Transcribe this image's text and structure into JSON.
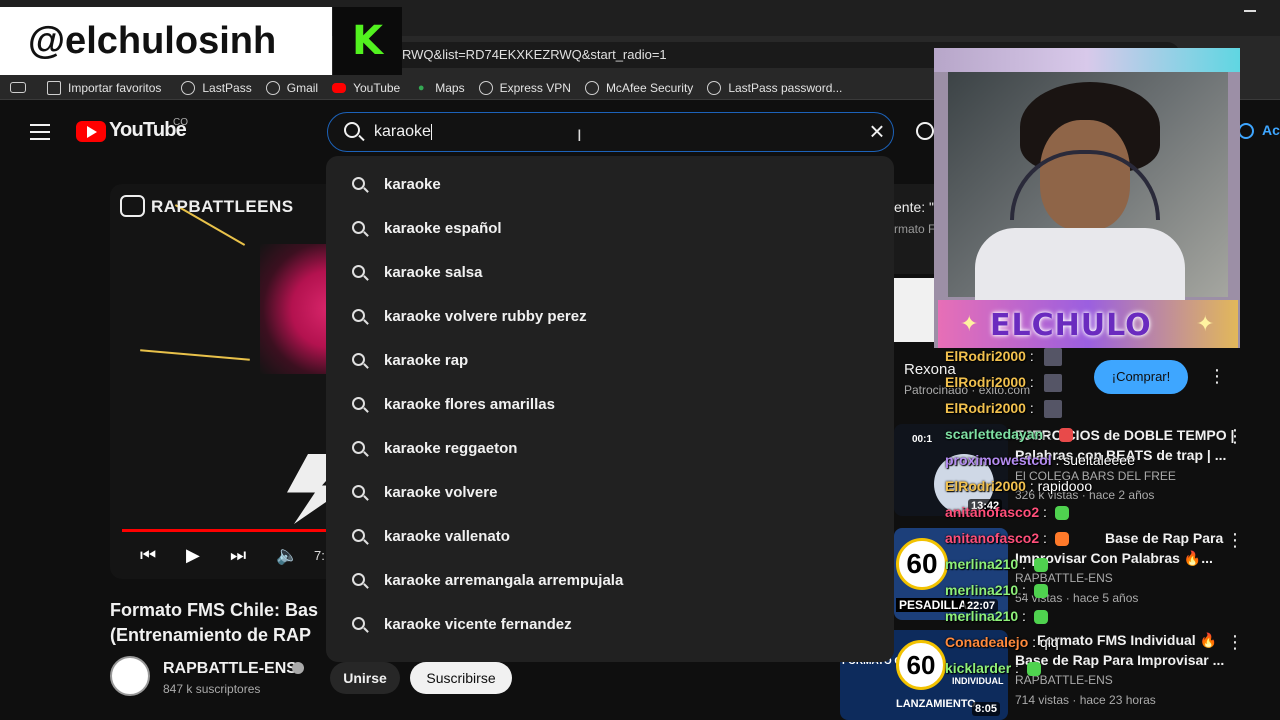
{
  "browser": {
    "url": "RWQ&list=RD74EKXKEZRWQ&start_radio=1",
    "bookmarks": [
      {
        "label": "Importar favoritos",
        "icon": "import-icon"
      },
      {
        "label": "LastPass",
        "icon": "globe-icon"
      },
      {
        "label": "Gmail",
        "icon": "globe-icon"
      },
      {
        "label": "YouTube",
        "icon": "youtube-icon"
      },
      {
        "label": "Maps",
        "icon": "maps-icon"
      },
      {
        "label": "Express VPN",
        "icon": "globe-icon"
      },
      {
        "label": "McAfee Security",
        "icon": "globe-icon"
      },
      {
        "label": "LastPass password...",
        "icon": "globe-icon"
      }
    ]
  },
  "overlay": {
    "handle": "@elchulosinh",
    "k_logo": "K",
    "webcam_banner": "ELCHULO"
  },
  "youtube": {
    "logo_text": "YouTube",
    "country": "CO",
    "search_value": "karaoke",
    "account_label": "Ac",
    "suggestions": [
      "karaoke",
      "karaoke español",
      "karaoke salsa",
      "karaoke volvere rubby perez",
      "karaoke rap",
      "karaoke flores amarillas",
      "karaoke reggaeton",
      "karaoke volvere",
      "karaoke vallenato",
      "karaoke arremangala arrempujala",
      "karaoke vicente fernandez"
    ]
  },
  "video": {
    "brand": "RAPBATTLEENS",
    "duration_partial": "7:",
    "title_line1": "Formato FMS Chile: Bas",
    "title_line2": "(Entrenamiento de RAP",
    "channel": "RAPBATTLE-ENS",
    "subscribers": "847 k suscriptores",
    "join_label": "Unirse",
    "subscribe_label": "Suscribirse"
  },
  "sidebar": {
    "partial_text_1": "ente: \"C",
    "partial_text_2": "rmato F",
    "ad": {
      "title": "Rexona",
      "meta": "Patrocinado · exito.com",
      "cta": "¡Comprar!"
    },
    "videos": [
      {
        "title_line1": "EJERCICIOS de DOBLE TEMPO |",
        "title_line2": "Palabras con BEATS de trap | ...",
        "channel": "El COLEGA BARS DEL FREE",
        "meta": "326 k vistas · hace 2 años",
        "duration": "13:42",
        "thumb_time": "00:1"
      },
      {
        "title_line1": "Base de Rap Para",
        "title_line2": "Improvisar Con Palabras 🔥...",
        "channel": "RAPBATTLE-ENS",
        "meta": "54 vistas · hace 5 años",
        "duration": "22:07",
        "thumb_num": "60",
        "thumb_label": "PESADILLA"
      },
      {
        "title_line1": "Formato FMS Individual 🔥",
        "title_line2": "Base de Rap Para Improvisar ...",
        "channel": "RAPBATTLE-ENS",
        "meta": "714 vistas · hace 23 horas",
        "duration": "8:05",
        "thumb_num": "60",
        "thumb_label": "LANZAMIENTO",
        "thumb_tag": "FORMATO CLASICO",
        "thumb_sub": "INDIVIDUAL"
      }
    ]
  },
  "chat": [
    {
      "user": "ElRodri2000",
      "msg": "",
      "color": "#f2c14e"
    },
    {
      "user": "ElRodri2000",
      "msg": "",
      "color": "#f2c14e"
    },
    {
      "user": "ElRodri2000",
      "msg": "",
      "color": "#f2c14e"
    },
    {
      "user": "scarlettedayan",
      "msg": "",
      "color": "#7ee0a3"
    },
    {
      "user": "proximowestcol",
      "msg": "sueltaleeee",
      "color": "#b58cf2"
    },
    {
      "user": "ElRodri2000",
      "msg": "rapidooo",
      "color": "#f2c14e"
    },
    {
      "user": "anitanofasco2",
      "msg": "",
      "color": "#ff4f7a"
    },
    {
      "user": "anitanofasco2",
      "msg": "",
      "color": "#ff4f7a"
    },
    {
      "user": "merlina210",
      "msg": "",
      "color": "#8ef07a"
    },
    {
      "user": "merlina210",
      "msg": "",
      "color": "#8ef07a"
    },
    {
      "user": "merlina210",
      "msg": "",
      "color": "#8ef07a"
    },
    {
      "user": "Conadealejo",
      "msg": "qiq",
      "color": "#ff8a3d"
    },
    {
      "user": "kicklarder",
      "msg": "",
      "color": "#8ef07a"
    }
  ]
}
